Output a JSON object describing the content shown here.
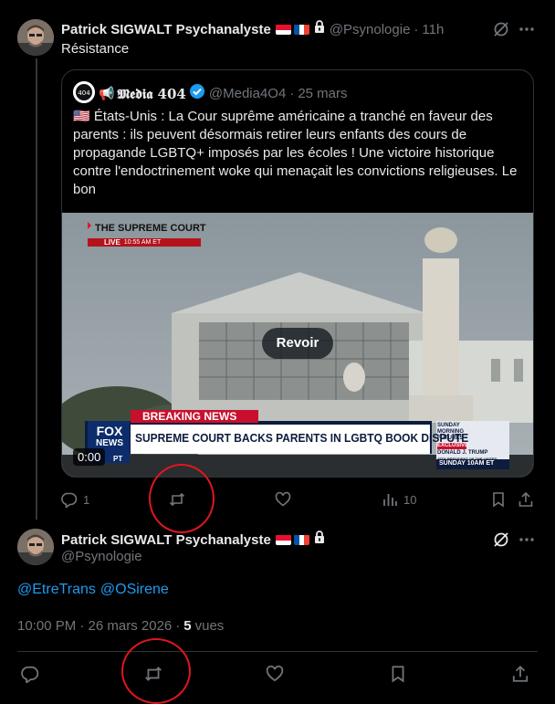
{
  "tweet1": {
    "author_name": "Patrick SIGWALT Psychanalyste",
    "handle": "@Psynologie",
    "time": "11h",
    "separator": "·",
    "text": "Résistance",
    "quote": {
      "author_name": "𝕸𝖊𝖉𝖎𝖆 404",
      "handle": "@Media4O4",
      "date": "25 mars",
      "separator": "·",
      "body": "🇺🇸 États-Unis : La Cour suprême américaine a tranché en faveur des parents : ils peuvent désormais retirer leurs enfants des cours de propagande LGBTQ+ imposés par les écoles ! Une victoire historique contre l'endoctrinement woke qui menaçait les convictions religieuses. Le bon",
      "video": {
        "replay_label": "Revoir",
        "timestamp": "0:00",
        "chyron_top": "THE SUPREME COURT",
        "live_label": "LIVE",
        "live_time": "10:55 AM ET",
        "breaking": "BREAKING NEWS",
        "headline": "SUPREME COURT BACKS PARENTS IN LGBTQ BOOK DISPUTE",
        "fox_line1": "FOX",
        "fox_line2": "NEWS",
        "sidebar_line1": "SUNDAY MORNING FUTURES",
        "sidebar_exclusive": "EXCLUSIVE",
        "sidebar_name": "DONALD J. TRUMP",
        "sidebar_sub": "45TH PRESIDENT OF THE UNITED STATES",
        "sidebar_time": "SUNDAY 10AM ET",
        "pt_label": "PT"
      }
    },
    "actions": {
      "replies": "1",
      "views": "10"
    }
  },
  "tweet2": {
    "author_name": "Patrick SIGWALT Psychanalyste",
    "handle": "@Psynologie",
    "mention1": "@EtreTrans",
    "mention2": "@OSirene",
    "timestamp": "10:00 PM · 26 mars 2026",
    "separator": "·",
    "views_count": "5",
    "views_label": "vues"
  },
  "icons": [
    "grok-icon",
    "more-icon",
    "reply-icon",
    "repost-icon",
    "like-icon",
    "views-icon",
    "bookmark-icon",
    "share-icon",
    "verified-icon",
    "lock-icon"
  ],
  "colors": {
    "background": "#000000",
    "text": "#e7e9ea",
    "muted": "#71767b",
    "link": "#1d9bf0",
    "highlight_circle": "#e0161e"
  }
}
